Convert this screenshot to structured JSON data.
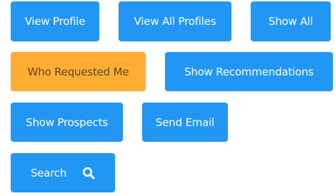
{
  "buttons": {
    "view_profile": "View Profile",
    "view_all_profiles": "View All Profiles",
    "show_all": "Show All",
    "who_requested_me": "Who Requested Me",
    "show_recommendations": "Show Recommendations",
    "show_prospects": "Show Prospects",
    "send_email": "Send Email",
    "search": "Search",
    "search_icon": "search-icon"
  },
  "colors": {
    "primary": "#2196f3",
    "active": "#ffad33",
    "active_text": "#5a4a2a"
  }
}
